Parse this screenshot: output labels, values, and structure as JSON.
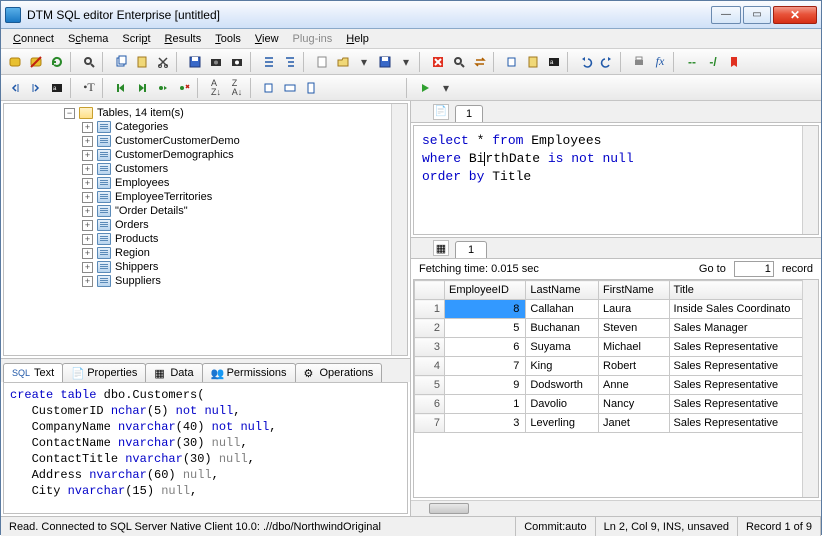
{
  "window": {
    "title": "DTM SQL editor Enterprise [untitled]"
  },
  "menu": {
    "connect": "Connect",
    "schema": "Schema",
    "script": "Script",
    "results": "Results",
    "tools": "Tools",
    "view": "View",
    "plugins": "Plug-ins",
    "help": "Help"
  },
  "tree": {
    "root": "Tables, 14 item(s)",
    "items": [
      "Categories",
      "CustomerCustomerDemo",
      "CustomerDemographics",
      "Customers",
      "Employees",
      "EmployeeTerritories",
      "\"Order Details\"",
      "Orders",
      "Products",
      "Region",
      "Shippers",
      "Suppliers"
    ]
  },
  "lowerTabs": {
    "text": "Text",
    "properties": "Properties",
    "data": "Data",
    "permissions": "Permissions",
    "operations": "Operations"
  },
  "ddl": {
    "l1a": "create table",
    "l1b": " dbo.Customers(",
    "l2a": "   CustomerID ",
    "l2b": "nchar",
    "l2c": "(5) ",
    "l2d": "not null",
    "l2e": ",",
    "l3a": "   CompanyName ",
    "l3b": "nvarchar",
    "l3c": "(40) ",
    "l3d": "not null",
    "l3e": ",",
    "l4a": "   ContactName ",
    "l4b": "nvarchar",
    "l4c": "(30) ",
    "l4d": "null",
    "l4e": ",",
    "l5a": "   ContactTitle ",
    "l5b": "nvarchar",
    "l5c": "(30) ",
    "l5d": "null",
    "l5e": ",",
    "l6a": "   Address ",
    "l6b": "nvarchar",
    "l6c": "(60) ",
    "l6d": "null",
    "l6e": ",",
    "l7a": "   City ",
    "l7b": "nvarchar",
    "l7c": "(15) ",
    "l7d": "null",
    "l7e": ","
  },
  "editorTab": "1",
  "sql": {
    "l1a": "select",
    "l1b": " * ",
    "l1c": "from",
    "l1d": " Employees",
    "l2a": "where",
    "l2b": " Bi",
    "l2c": "rthDate ",
    "l2d": "is not null",
    "l3a": "order by",
    "l3b": " Title"
  },
  "resultTab": "1",
  "resultInfo": {
    "fetching": "Fetching time: 0.015 sec",
    "goto": "Go to",
    "gotoVal": "1",
    "record": "record"
  },
  "grid": {
    "cols": [
      "EmployeeID",
      "LastName",
      "FirstName",
      "Title"
    ],
    "rows": [
      {
        "n": "1",
        "id": "8",
        "ln": "Callahan",
        "fn": "Laura",
        "t": "Inside Sales Coordinato"
      },
      {
        "n": "2",
        "id": "5",
        "ln": "Buchanan",
        "fn": "Steven",
        "t": "Sales Manager"
      },
      {
        "n": "3",
        "id": "6",
        "ln": "Suyama",
        "fn": "Michael",
        "t": "Sales Representative"
      },
      {
        "n": "4",
        "id": "7",
        "ln": "King",
        "fn": "Robert",
        "t": "Sales Representative"
      },
      {
        "n": "5",
        "id": "9",
        "ln": "Dodsworth",
        "fn": "Anne",
        "t": "Sales Representative"
      },
      {
        "n": "6",
        "id": "1",
        "ln": "Davolio",
        "fn": "Nancy",
        "t": "Sales Representative"
      },
      {
        "n": "7",
        "id": "3",
        "ln": "Leverling",
        "fn": "Janet",
        "t": "Sales Representative"
      }
    ]
  },
  "status": {
    "conn": "Read. Connected to SQL Server Native Client 10.0: .//dbo/NorthwindOriginal",
    "commit": "Commit:auto",
    "pos": "Ln 2, Col 9, INS, unsaved",
    "rec": "Record 1 of 9"
  }
}
